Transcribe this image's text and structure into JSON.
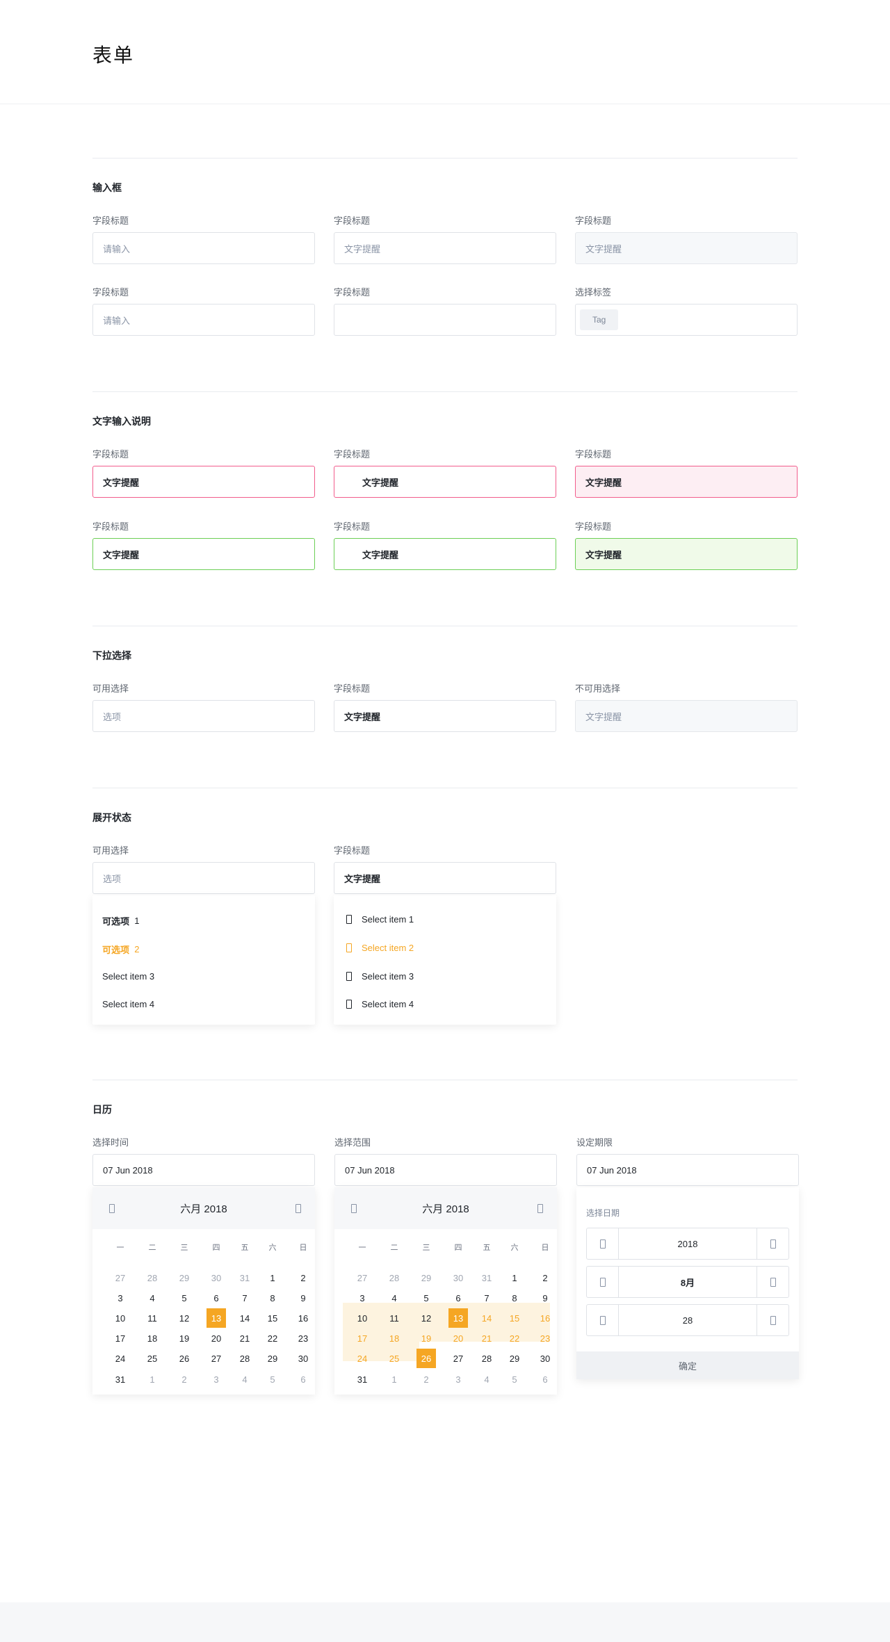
{
  "page": {
    "title": "表单"
  },
  "inputs": {
    "title": "输入框",
    "row1": [
      {
        "label": "字段标题",
        "value": "请输入"
      },
      {
        "label": "字段标题",
        "value": "文字提醒"
      },
      {
        "label": "字段标题",
        "value": "文字提醒"
      }
    ],
    "row2": [
      {
        "label": "字段标题",
        "value": "请输入"
      },
      {
        "label": "字段标题",
        "value": ""
      },
      {
        "label": "选择标签",
        "tag": "Tag"
      }
    ]
  },
  "validation": {
    "title": "文字输入说明",
    "error_row": [
      {
        "label": "字段标题",
        "value": "文字提醒"
      },
      {
        "label": "字段标题",
        "value": "文字提醒"
      },
      {
        "label": "字段标题",
        "value": "文字提醒"
      }
    ],
    "success_row": [
      {
        "label": "字段标题",
        "value": "文字提醒"
      },
      {
        "label": "字段标题",
        "value": "文字提醒"
      },
      {
        "label": "字段标题",
        "value": "文字提醒"
      }
    ],
    "colors": {
      "error": "#f25c8c",
      "success": "#6ccf55"
    }
  },
  "selects": {
    "title": "下拉选择",
    "items": [
      {
        "label": "可用选择",
        "value": "选项"
      },
      {
        "label": "字段标题",
        "value": "文字提醒"
      },
      {
        "label": "不可用选择",
        "value": "文字提醒"
      }
    ]
  },
  "expanded": {
    "title": "展开状态",
    "single": {
      "label": "可用选择",
      "value": "选项",
      "options": [
        {
          "text": "可选项",
          "num": "1"
        },
        {
          "text": "可选项",
          "num": "2"
        },
        {
          "text": "Select item 3",
          "num": ""
        },
        {
          "text": "Select item 4",
          "num": ""
        }
      ]
    },
    "multi": {
      "label": "字段标题",
      "value": "文字提醒",
      "options": [
        "Select item 1",
        "Select item 2",
        "Select item 3",
        "Select item 4"
      ]
    },
    "accent": "#f5a623"
  },
  "calendar": {
    "title": "日历",
    "pickers": [
      {
        "label": "选择时间",
        "value": "07 Jun 2018"
      },
      {
        "label": "选择范围",
        "value": "07 Jun 2018"
      },
      {
        "label": "设定期限",
        "value": "07 Jun 2018"
      }
    ],
    "month_title": "六月 2018",
    "weekdays": [
      "一",
      "二",
      "三",
      "四",
      "五",
      "六",
      "日"
    ],
    "weeks": [
      [
        "27",
        "28",
        "29",
        "30",
        "31",
        "1",
        "2"
      ],
      [
        "3",
        "4",
        "5",
        "6",
        "7",
        "8",
        "9"
      ],
      [
        "10",
        "11",
        "12",
        "13",
        "14",
        "15",
        "16"
      ],
      [
        "17",
        "18",
        "19",
        "20",
        "21",
        "22",
        "23"
      ],
      [
        "24",
        "25",
        "26",
        "27",
        "28",
        "29",
        "30"
      ],
      [
        "31",
        "1",
        "2",
        "3",
        "4",
        "5",
        "6"
      ]
    ],
    "deadline": {
      "title": "选择日期",
      "year": "2018",
      "month": "8月",
      "day": "28",
      "confirm": "确定"
    }
  }
}
